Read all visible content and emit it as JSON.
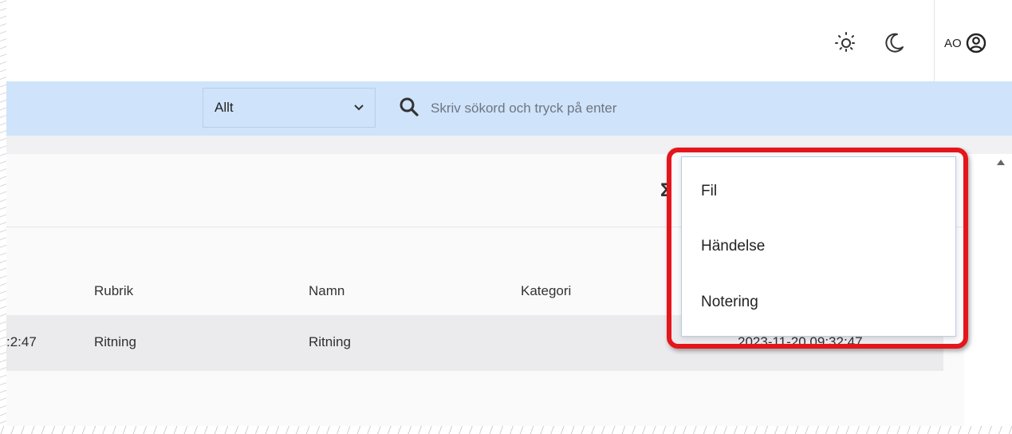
{
  "header": {
    "user_initials": "AO",
    "sun_icon": "sun-icon",
    "moon_icon": "moon-icon",
    "user_icon": "user-circle-icon"
  },
  "search": {
    "scope_value": "Allt",
    "placeholder": "Skriv sökord och tryck på enter"
  },
  "table": {
    "columns": [
      "Rubrik",
      "Namn",
      "Kategori"
    ],
    "rows": [
      {
        "time_fragment": ":2:47",
        "rubrik": "Ritning",
        "namn": "Ritning",
        "date": "2023-11-20 09:32:47"
      }
    ]
  },
  "menu": {
    "items": [
      "Fil",
      "Händelse",
      "Notering"
    ]
  },
  "colors": {
    "searchbar_bg": "#cfe3fb",
    "highlight": "#e4161b"
  }
}
